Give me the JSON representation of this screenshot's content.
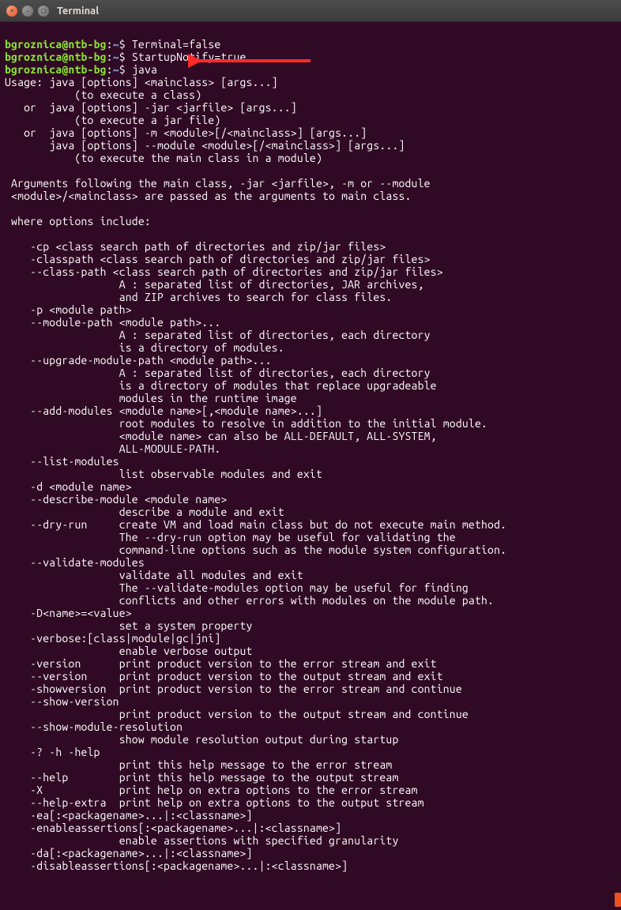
{
  "window": {
    "title": "Terminal"
  },
  "prompt": {
    "user": "bgroznica",
    "at": "@",
    "host": "ntb-bg",
    "colon": ":",
    "path": "~",
    "dollar": "$"
  },
  "commands": {
    "c1": "Terminal=false",
    "c2": "StartupNotify=true",
    "c3": "java"
  },
  "output": {
    "l00": "Usage: java [options] <mainclass> [args...]",
    "l01": "           (to execute a class)",
    "l02": "   or  java [options] -jar <jarfile> [args...]",
    "l03": "           (to execute a jar file)",
    "l04": "   or  java [options] -m <module>[/<mainclass>] [args...]",
    "l05": "       java [options] --module <module>[/<mainclass>] [args...]",
    "l06": "           (to execute the main class in a module)",
    "l07": "",
    "l08": " Arguments following the main class, -jar <jarfile>, -m or --module",
    "l09": " <module>/<mainclass> are passed as the arguments to main class.",
    "l10": "",
    "l11": " where options include:",
    "l12": "",
    "l13": "    -cp <class search path of directories and zip/jar files>",
    "l14": "    -classpath <class search path of directories and zip/jar files>",
    "l15": "    --class-path <class search path of directories and zip/jar files>",
    "l16": "                  A : separated list of directories, JAR archives,",
    "l17": "                  and ZIP archives to search for class files.",
    "l18": "    -p <module path>",
    "l19": "    --module-path <module path>...",
    "l20": "                  A : separated list of directories, each directory",
    "l21": "                  is a directory of modules.",
    "l22": "    --upgrade-module-path <module path>...",
    "l23": "                  A : separated list of directories, each directory",
    "l24": "                  is a directory of modules that replace upgradeable",
    "l25": "                  modules in the runtime image",
    "l26": "    --add-modules <module name>[,<module name>...]",
    "l27": "                  root modules to resolve in addition to the initial module.",
    "l28": "                  <module name> can also be ALL-DEFAULT, ALL-SYSTEM,",
    "l29": "                  ALL-MODULE-PATH.",
    "l30": "    --list-modules",
    "l31": "                  list observable modules and exit",
    "l32": "    -d <module name>",
    "l33": "    --describe-module <module name>",
    "l34": "                  describe a module and exit",
    "l35": "    --dry-run     create VM and load main class but do not execute main method.",
    "l36": "                  The --dry-run option may be useful for validating the",
    "l37": "                  command-line options such as the module system configuration.",
    "l38": "    --validate-modules",
    "l39": "                  validate all modules and exit",
    "l40": "                  The --validate-modules option may be useful for finding",
    "l41": "                  conflicts and other errors with modules on the module path.",
    "l42": "    -D<name>=<value>",
    "l43": "                  set a system property",
    "l44": "    -verbose:[class|module|gc|jni]",
    "l45": "                  enable verbose output",
    "l46": "    -version      print product version to the error stream and exit",
    "l47": "    --version     print product version to the output stream and exit",
    "l48": "    -showversion  print product version to the error stream and continue",
    "l49": "    --show-version",
    "l50": "                  print product version to the output stream and continue",
    "l51": "    --show-module-resolution",
    "l52": "                  show module resolution output during startup",
    "l53": "    -? -h -help",
    "l54": "                  print this help message to the error stream",
    "l55": "    --help        print this help message to the output stream",
    "l56": "    -X            print help on extra options to the error stream",
    "l57": "    --help-extra  print help on extra options to the output stream",
    "l58": "    -ea[:<packagename>...|:<classname>]",
    "l59": "    -enableassertions[:<packagename>...|:<classname>]",
    "l60": "                  enable assertions with specified granularity",
    "l61": "    -da[:<packagename>...|:<classname>]",
    "l62": "    -disableassertions[:<packagename>...|:<classname>]"
  }
}
